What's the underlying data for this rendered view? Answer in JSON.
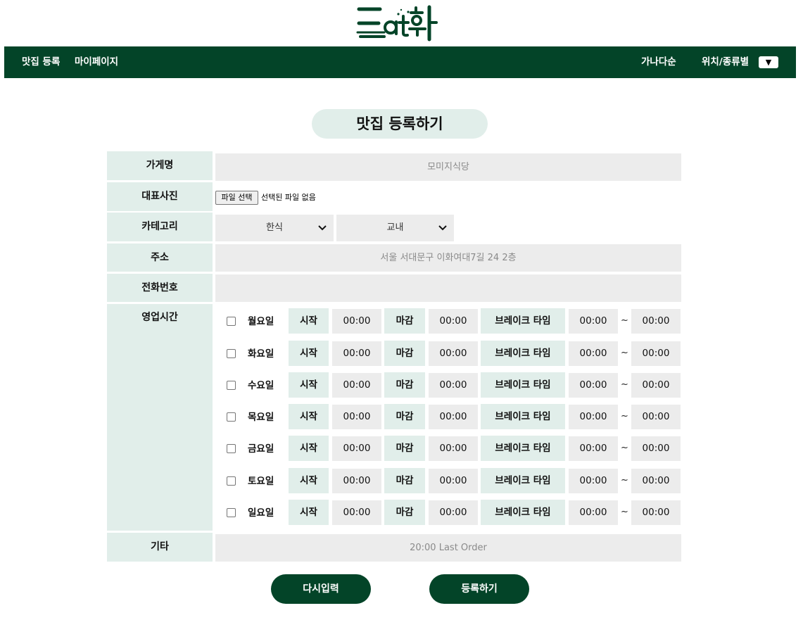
{
  "logo": {
    "text": "Eat화",
    "color": "#034428"
  },
  "nav": {
    "left_items": [
      "맛집 등록",
      "마이페이지"
    ],
    "sort_label": "가나다순",
    "filter_label": "위치/종류별",
    "dropdown_icon": "▼",
    "background": "#034428"
  },
  "page_title": "맛집 등록하기",
  "form": {
    "labels": {
      "name": "가게명",
      "photo": "대표사진",
      "category": "카테고리",
      "address": "주소",
      "phone": "전화번호",
      "hours": "영업시간",
      "etc": "기타"
    },
    "name_placeholder": "모미지식당",
    "file_button": "파일 선택",
    "file_status": "선택된 파일 없음",
    "category_1": "한식",
    "category_2": "교내",
    "address_placeholder": "서울 서대문구 이화여대7길 24 2층",
    "phone_value": "",
    "etc_placeholder": "20:00 Last Order",
    "hours_labels": {
      "start": "시작",
      "end": "마감",
      "break": "브레이크 타임",
      "tilde": "~"
    },
    "days": [
      {
        "name": "월요일",
        "checked": false,
        "open": "00:00",
        "close": "00:00",
        "break_start": "00:00",
        "break_end": "00:00"
      },
      {
        "name": "화요일",
        "checked": false,
        "open": "00:00",
        "close": "00:00",
        "break_start": "00:00",
        "break_end": "00:00"
      },
      {
        "name": "수요일",
        "checked": false,
        "open": "00:00",
        "close": "00:00",
        "break_start": "00:00",
        "break_end": "00:00"
      },
      {
        "name": "목요일",
        "checked": false,
        "open": "00:00",
        "close": "00:00",
        "break_start": "00:00",
        "break_end": "00:00"
      },
      {
        "name": "금요일",
        "checked": false,
        "open": "00:00",
        "close": "00:00",
        "break_start": "00:00",
        "break_end": "00:00"
      },
      {
        "name": "토요일",
        "checked": false,
        "open": "00:00",
        "close": "00:00",
        "break_start": "00:00",
        "break_end": "00:00"
      },
      {
        "name": "일요일",
        "checked": false,
        "open": "00:00",
        "close": "00:00",
        "break_start": "00:00",
        "break_end": "00:00"
      }
    ]
  },
  "buttons": {
    "reset": "다시입력",
    "submit": "등록하기"
  },
  "colors": {
    "accent": "#034428",
    "label_bg": "#e1eeea",
    "field_bg": "#ececec"
  }
}
